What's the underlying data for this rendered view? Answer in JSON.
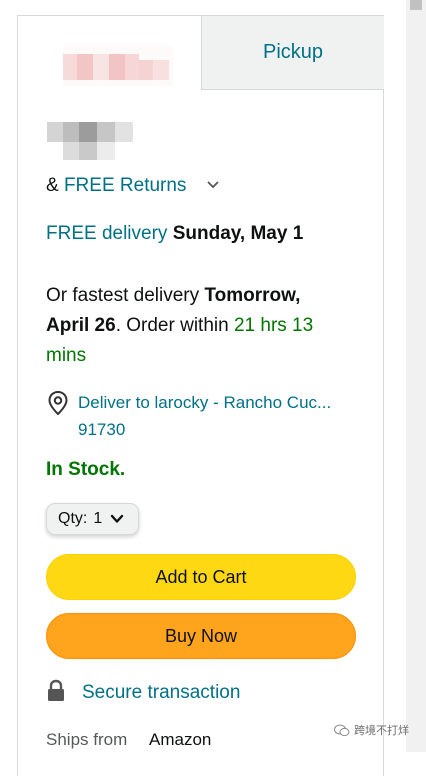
{
  "tabs": {
    "pickup_label": "Pickup"
  },
  "returns": {
    "prefix": "& ",
    "link": "FREE Returns"
  },
  "delivery": {
    "free_prefix": "FREE delivery ",
    "free_date": "Sunday, May 1",
    "fastest_prefix": "Or fastest delivery ",
    "fastest_date_line1": "Tomorrow,",
    "fastest_date_line2": "April 26",
    "order_within_text": ". Order within ",
    "countdown_line1": "21 hrs 13",
    "countdown_line2": "mins"
  },
  "location": {
    "line1": "Deliver to larocky - Rancho Cuc...",
    "line2": "91730"
  },
  "stock": {
    "status": "In Stock."
  },
  "quantity": {
    "label": "Qty:",
    "value": "1"
  },
  "buttons": {
    "add_to_cart": "Add to Cart",
    "buy_now": "Buy Now"
  },
  "secure": {
    "label": "Secure transaction"
  },
  "ships": {
    "label": "Ships from",
    "value": "Amazon"
  },
  "watermark": {
    "text": "跨境不打烊"
  },
  "colors": {
    "link": "#007185",
    "in_stock": "#007600",
    "add_to_cart": "#FFD814",
    "buy_now": "#FFA41C"
  }
}
